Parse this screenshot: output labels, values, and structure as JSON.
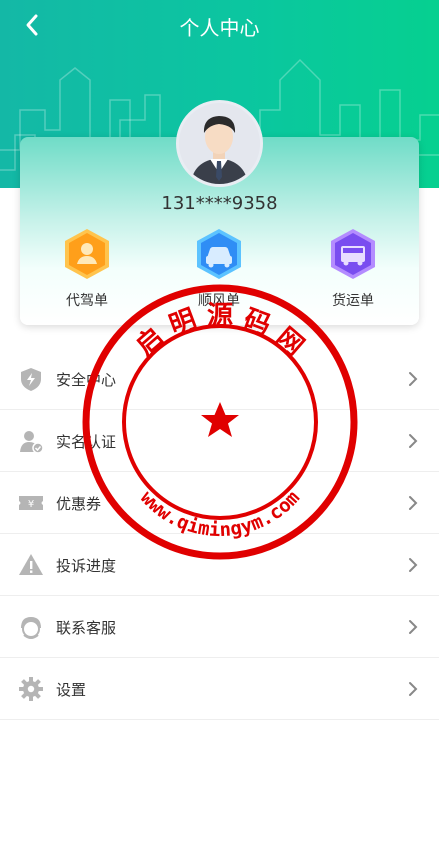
{
  "header": {
    "title": "个人中心",
    "back_icon": "back-arrow-icon"
  },
  "profile": {
    "phone": "131****9358",
    "avatar_icon": "user-avatar-icon"
  },
  "services": [
    {
      "label": "代驾单",
      "icon": "driver-icon",
      "color": "#ff9f1a"
    },
    {
      "label": "顺风单",
      "icon": "car-icon",
      "color": "#2f8df5"
    },
    {
      "label": "货运单",
      "icon": "truck-icon",
      "color": "#7a4df0"
    }
  ],
  "menu": [
    {
      "label": "安全中心",
      "icon": "shield-icon"
    },
    {
      "label": "实名认证",
      "icon": "verified-user-icon"
    },
    {
      "label": "优惠券",
      "icon": "coupon-icon"
    },
    {
      "label": "投诉进度",
      "icon": "warning-icon"
    },
    {
      "label": "联系客服",
      "icon": "customer-service-icon"
    },
    {
      "label": "设置",
      "icon": "gear-icon"
    }
  ],
  "watermark": {
    "text_top": "启 明 源 码 网",
    "text_bottom": "www.qimingym.com",
    "color": "#e00000"
  }
}
